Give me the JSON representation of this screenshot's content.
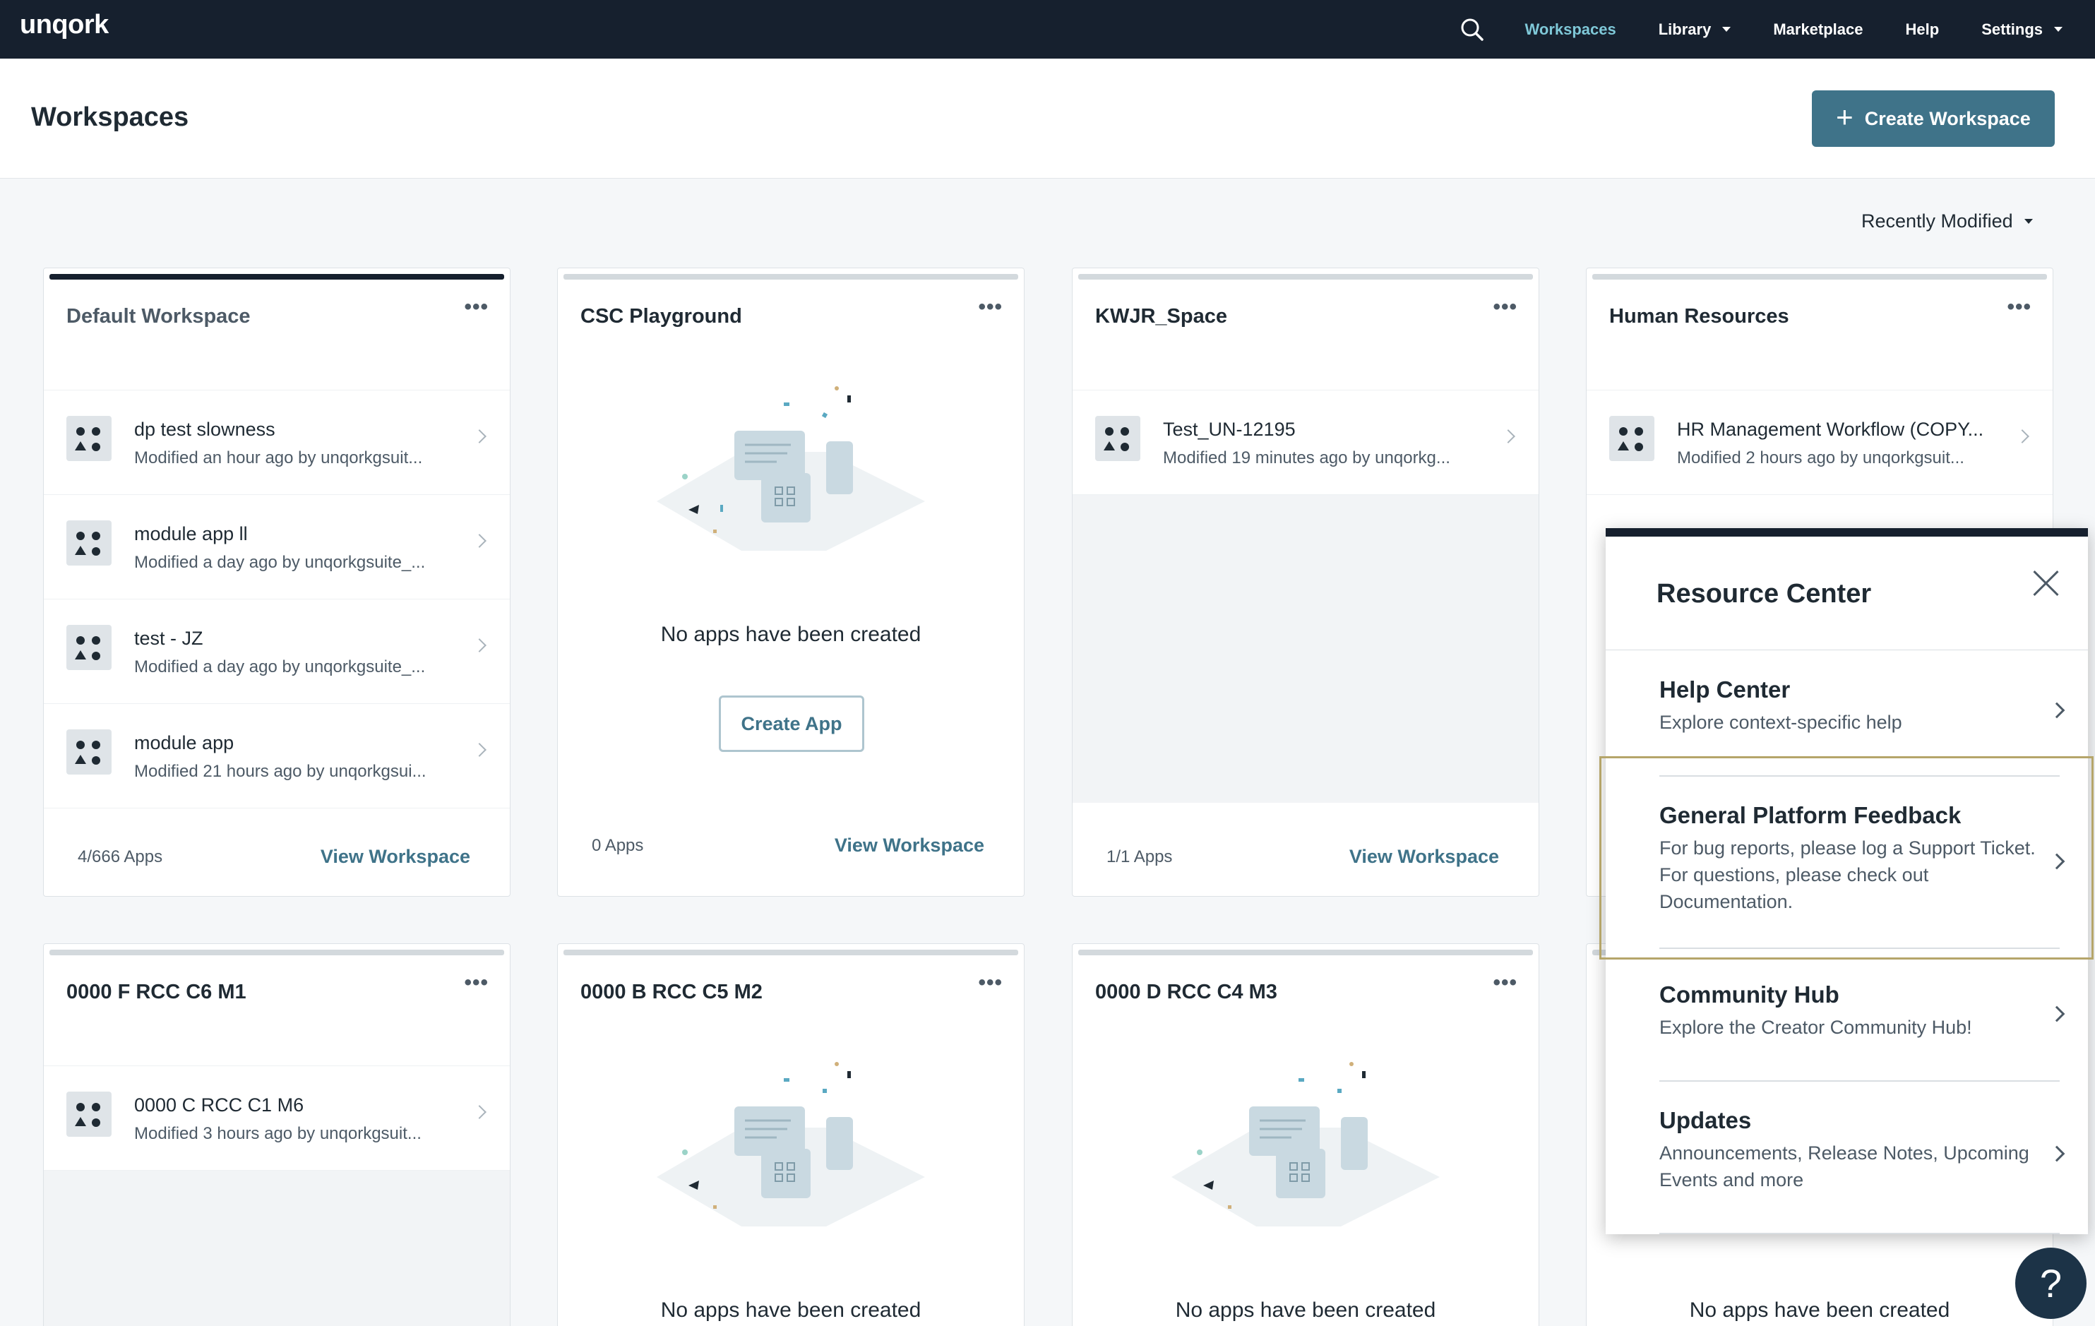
{
  "app": {
    "logo": "unqork"
  },
  "nav": {
    "workspaces": "Workspaces",
    "library": "Library",
    "marketplace": "Marketplace",
    "help": "Help",
    "settings": "Settings"
  },
  "header": {
    "title": "Workspaces",
    "create_label": "Create Workspace",
    "create_plus": "+"
  },
  "sort": {
    "label": "Recently Modified"
  },
  "cards": [
    {
      "title": "Default Workspace",
      "menu": "•••",
      "apps": [
        {
          "name": "dp test slowness",
          "meta": "Modified an hour ago by unqorkgsuit..."
        },
        {
          "name": "module app ll",
          "meta": "Modified a day ago by unqorkgsuite_..."
        },
        {
          "name": "test - JZ",
          "meta": "Modified a day ago by unqorkgsuite_..."
        },
        {
          "name": "module app",
          "meta": "Modified 21 hours ago by unqorkgsui..."
        }
      ],
      "count": "4/666 Apps",
      "link": "View Workspace"
    },
    {
      "title": "CSC Playground",
      "menu": "•••",
      "empty": "No apps have been created",
      "create_app": "Create App",
      "count": "0 Apps",
      "link": "View Workspace"
    },
    {
      "title": "KWJR_Space",
      "menu": "•••",
      "apps": [
        {
          "name": "Test_UN-12195",
          "meta": "Modified 19 minutes ago by unqorkg..."
        }
      ],
      "count": "1/1 Apps",
      "link": "View Workspace"
    },
    {
      "title": "Human Resources",
      "menu": "•••",
      "apps": [
        {
          "name": "HR Management Workflow (COPY...",
          "meta": "Modified 2 hours ago by unqorkgsuit..."
        }
      ]
    },
    {
      "title": "0000 F RCC C6 M1",
      "menu": "•••",
      "apps": [
        {
          "name": "0000 C RCC C1 M6",
          "meta": "Modified 3 hours ago by unqorkgsuit..."
        }
      ]
    },
    {
      "title": "0000 B RCC C5 M2",
      "menu": "•••",
      "empty": "No apps have been created"
    },
    {
      "title": "0000 D RCC C4 M3",
      "menu": "•••",
      "empty": "No apps have been created"
    },
    {
      "empty": "No apps have been created"
    }
  ],
  "resource_center": {
    "title": "Resource Center",
    "items": [
      {
        "title": "Help Center",
        "desc": "Explore context-specific help"
      },
      {
        "title": "General Platform Feedback",
        "desc": "For bug reports, please log a Support Ticket. For questions, please check out Documentation."
      },
      {
        "title": "Community Hub",
        "desc": "Explore the Creator Community Hub!"
      },
      {
        "title": "Updates",
        "desc": "Announcements, Release Notes, Upcoming Events and more"
      }
    ]
  },
  "help_fab": "?"
}
